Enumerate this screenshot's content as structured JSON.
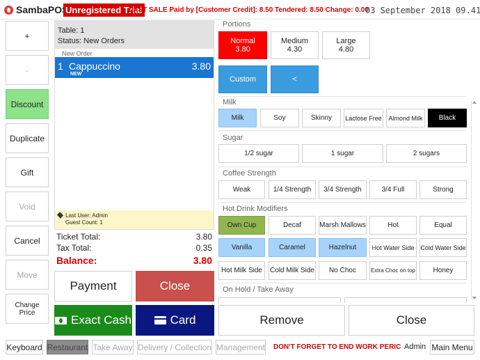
{
  "app": {
    "name": "SambaPOS",
    "trial_badge": "Unregistered Trial",
    "last_sale": "LAST SALE Paid by [Customer Credit]: 8.50  Tendered: 8.50  Change: 0.00",
    "datetime": "03 September 2018 09.41"
  },
  "left_buttons": [
    {
      "label": "+",
      "state": "normal"
    },
    {
      "label": "-",
      "state": "disabled"
    },
    {
      "label": "Discount",
      "state": "green"
    },
    {
      "label": "Duplicate",
      "state": "normal"
    },
    {
      "label": "Gift",
      "state": "normal"
    },
    {
      "label": "Void",
      "state": "disabled"
    },
    {
      "label": "Cancel",
      "state": "normal"
    },
    {
      "label": "Move",
      "state": "disabled"
    },
    {
      "label": "Change Price",
      "state": "small"
    }
  ],
  "ticket": {
    "table": "Table: 1",
    "status": "Status: New Orders",
    "new_order_label": "New Order",
    "order": {
      "qty": "1",
      "name": "Cappuccino",
      "price": "3.80",
      "tag": "NEW"
    },
    "last_user": "Last User: Admin",
    "guest_count": "Guest Count: 1",
    "ticket_total_label": "Ticket Total:",
    "ticket_total": "3.80",
    "tax_total_label": "Tax Total:",
    "tax_total": "0.35",
    "balance_label": "Balance:",
    "balance": "3.80"
  },
  "actions": {
    "payment": "Payment",
    "close": "Close",
    "exact_cash": "Exact Cash",
    "card": "Card"
  },
  "portions": {
    "title": "Portions",
    "items": [
      {
        "name": "Normal",
        "price": "3.80"
      },
      {
        "name": "Medium",
        "price": "4.30"
      },
      {
        "name": "Large",
        "price": "4.80"
      }
    ],
    "custom": "Custom",
    "back": "<"
  },
  "milk": {
    "title": "Milk",
    "items": [
      "Milk",
      "Soy",
      "Skinny",
      "Lactose Free",
      "Almond Milk",
      "Black"
    ]
  },
  "sugar": {
    "title": "Sugar",
    "items": [
      "1/2 sugar",
      "1 sugar",
      "2 sugars"
    ]
  },
  "strength": {
    "title": "Coffee Strength",
    "items": [
      "Weak",
      "1/4 Strength",
      "3/4 Strength",
      "3/4 Full",
      "Strong"
    ]
  },
  "modifiers": {
    "title": "Hot Drink Modifiers",
    "items": [
      "Own Cup",
      "Decaf",
      "Marsh Mallows",
      "Hot",
      "Equal",
      "Vanilla",
      "Caramel",
      "Hazelnut",
      "Hot Water Side",
      "Cold Water Side",
      "Hot Milk Side",
      "Cold Milk Side",
      "No Choc",
      "Extra Choc on top",
      "Honey"
    ]
  },
  "onhold": {
    "title": "On Hold / Take Away"
  },
  "right_actions": {
    "remove": "Remove",
    "close": "Close"
  },
  "footer": {
    "keyboard": "Keyboard",
    "restaurant": "Restaurant",
    "take_away": "Take Away",
    "delivery": "Delivery / Collection",
    "management": "Management",
    "warning": "DON'T FORGET TO END WORK PERIC",
    "admin": "Admin",
    "main_menu": "Main Menu"
  },
  "colors": {
    "accent_blue": "#1976d2",
    "red": "#d50000",
    "green_btn": "#8ee28a",
    "selected_blue": "#a7d3fa",
    "olive": "#92b552",
    "close_red": "#c9504c",
    "exact_cash_green": "#1a8a1a",
    "card_navy": "#0a1780"
  }
}
